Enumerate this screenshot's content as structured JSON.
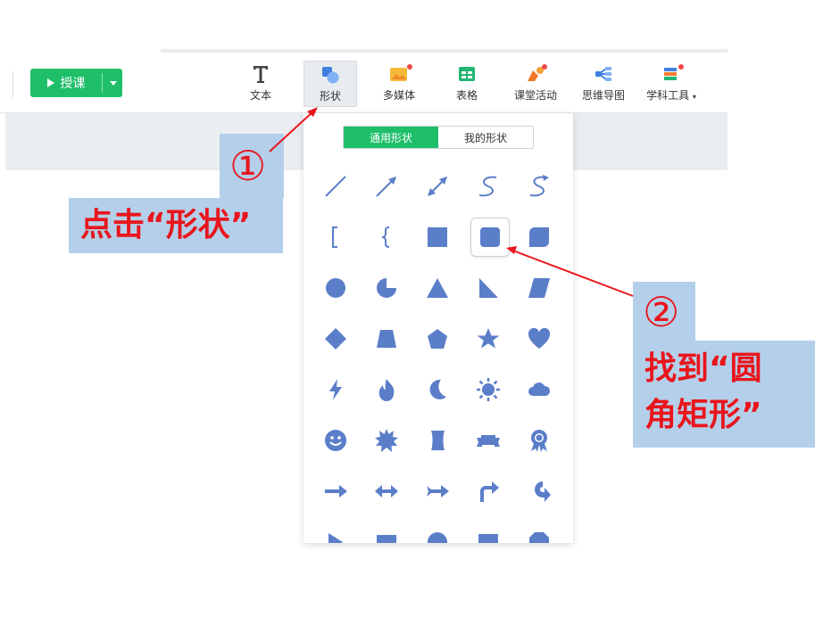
{
  "toolbar": {
    "teach_button": "授课",
    "tools": [
      {
        "label": "文本",
        "icon": "text-icon"
      },
      {
        "label": "形状",
        "icon": "shape-icon"
      },
      {
        "label": "多媒体",
        "icon": "multimedia-icon"
      },
      {
        "label": "表格",
        "icon": "table-icon"
      },
      {
        "label": "课堂活动",
        "icon": "class-activity-icon"
      },
      {
        "label": "思维导图",
        "icon": "mindmap-icon"
      },
      {
        "label": "学科工具",
        "icon": "subject-tools-icon"
      }
    ],
    "active_tool": "形状"
  },
  "shape_panel": {
    "tabs": [
      "通用形状",
      "我的形状"
    ],
    "active_tab": "通用形状",
    "shape_color": "#5b7ec9",
    "selected_shape": "rounded-rectangle",
    "shapes": [
      [
        "line",
        "arrow-line",
        "double-arrow-line",
        "curve",
        "curve-arrow"
      ],
      [
        "bracket",
        "brace",
        "square",
        "rounded-rectangle",
        "rounded-corner-square"
      ],
      [
        "circle",
        "pie",
        "triangle",
        "right-triangle",
        "parallelogram"
      ],
      [
        "diamond",
        "trapezoid",
        "pentagon",
        "star",
        "heart"
      ],
      [
        "lightning",
        "flame",
        "moon",
        "sun",
        "cloud"
      ],
      [
        "smiley",
        "burst",
        "scroll",
        "ribbon",
        "award"
      ],
      [
        "right-arrow",
        "left-right-arrow",
        "notched-arrow",
        "bent-arrow",
        "u-turn-arrow"
      ]
    ]
  },
  "annotations": {
    "step1_number": "①",
    "step1_text": "点击“形状”",
    "step2_number": "②",
    "step2_line1": "找到“圆",
    "step2_line2": "角矩形”",
    "color": "#e8161c"
  }
}
